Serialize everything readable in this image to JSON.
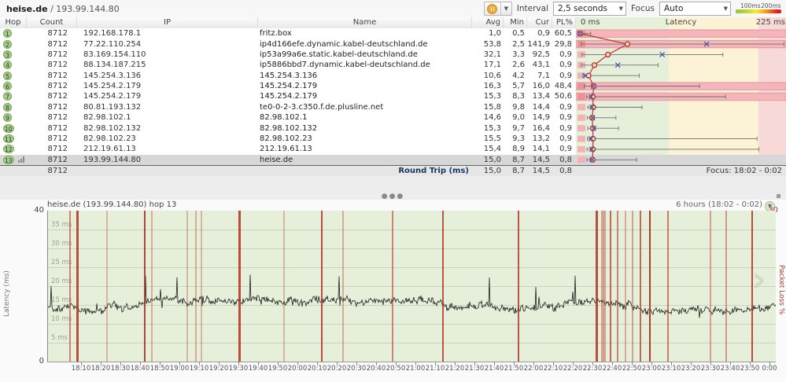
{
  "titlebar": {
    "host": "heise.de",
    "sep": " / ",
    "ip": "193.99.144.80",
    "interval": {
      "label": "Interval",
      "value": "2,5 seconds"
    },
    "focus": {
      "label": "Focus",
      "value": "Auto"
    },
    "scale_legend": {
      "label1": "100ms",
      "label2": "200ms"
    }
  },
  "table": {
    "headers": {
      "hop": "Hop",
      "count": "Count",
      "ip": "IP",
      "name": "Name",
      "avg": "Avg",
      "min": "Min",
      "cur": "Cur",
      "pl": "PL%"
    },
    "latency_axis": {
      "min": "0 ms",
      "title": "Latency",
      "max": "225 ms",
      "scale_max_ms": 225,
      "zone_green_ms": 100,
      "zone_yellow_ms": 200
    },
    "rows": [
      {
        "hop": "1",
        "count": "8712",
        "ip": "192.168.178.1",
        "name": "fritz.box",
        "avg": "1,0",
        "min": "0,5",
        "cur": "0,9",
        "pl": "60,5",
        "graph": {
          "min": 0.5,
          "avg": 1.0,
          "cur": 0.9,
          "max": 13,
          "loss_band": true
        },
        "selected": false
      },
      {
        "hop": "2",
        "count": "8712",
        "ip": "77.22.110.254",
        "name": "ip4d166efe.dynamic.kabel-deutschland.de",
        "avg": "53,8",
        "min": "2,5",
        "cur": "141,9",
        "pl": "29,8",
        "graph": {
          "min": 2.5,
          "avg": 53.8,
          "cur": 141.9,
          "max": 228,
          "loss_band": true
        },
        "selected": false
      },
      {
        "hop": "3",
        "count": "8712",
        "ip": "83.169.154.110",
        "name": "ip53a99a6e.static.kabel-deutschland.de",
        "avg": "32,1",
        "min": "3,3",
        "cur": "92,5",
        "pl": "0,9",
        "graph": {
          "min": 3.3,
          "avg": 32.1,
          "cur": 92.5,
          "max": 160,
          "loss_band": false
        },
        "selected": false
      },
      {
        "hop": "4",
        "count": "8712",
        "ip": "88.134.187.215",
        "name": "ip5886bbd7.dynamic.kabel-deutschland.de",
        "avg": "17,1",
        "min": "2,6",
        "cur": "43,1",
        "pl": "0,9",
        "graph": {
          "min": 2.6,
          "avg": 17.1,
          "cur": 43.1,
          "max": 88,
          "loss_band": false
        },
        "selected": false
      },
      {
        "hop": "5",
        "count": "8712",
        "ip": "145.254.3.136",
        "name": "145.254.3.136",
        "avg": "10,6",
        "min": "4,2",
        "cur": "7,1",
        "pl": "0,9",
        "graph": {
          "min": 4.2,
          "avg": 10.6,
          "cur": 7.1,
          "max": 67,
          "loss_band": false
        },
        "selected": false
      },
      {
        "hop": "6",
        "count": "8712",
        "ip": "145.254.2.179",
        "name": "145.254.2.179",
        "avg": "16,3",
        "min": "5,7",
        "cur": "16,0",
        "pl": "48,4",
        "graph": {
          "min": 5.7,
          "avg": 16.3,
          "cur": 16.0,
          "max": 134,
          "loss_band": true
        },
        "selected": false
      },
      {
        "hop": "7",
        "count": "8712",
        "ip": "145.254.2.179",
        "name": "145.254.2.179",
        "avg": "15,3",
        "min": "8,3",
        "cur": "13,4",
        "pl": "50,6",
        "graph": {
          "min": 8.3,
          "avg": 15.3,
          "cur": 13.4,
          "max": 163,
          "loss_band": true
        },
        "selected": false
      },
      {
        "hop": "8",
        "count": "8712",
        "ip": "80.81.193.132",
        "name": "te0-0-2-3.c350.f.de.plusline.net",
        "avg": "15,8",
        "min": "9,8",
        "cur": "14,4",
        "pl": "0,9",
        "graph": {
          "min": 9.8,
          "avg": 15.8,
          "cur": 14.4,
          "max": 70,
          "loss_band": false
        },
        "selected": false
      },
      {
        "hop": "9",
        "count": "8712",
        "ip": "82.98.102.1",
        "name": "82.98.102.1",
        "avg": "14,6",
        "min": "9,0",
        "cur": "14,9",
        "pl": "0,9",
        "graph": {
          "min": 9.0,
          "avg": 14.6,
          "cur": 14.9,
          "max": 41,
          "loss_band": false
        },
        "selected": false
      },
      {
        "hop": "10",
        "count": "8712",
        "ip": "82.98.102.132",
        "name": "82.98.102.132",
        "avg": "15,3",
        "min": "9,7",
        "cur": "16,4",
        "pl": "0,9",
        "graph": {
          "min": 9.7,
          "avg": 15.3,
          "cur": 16.4,
          "max": 44,
          "loss_band": false
        },
        "selected": false
      },
      {
        "hop": "11",
        "count": "8712",
        "ip": "82.98.102.23",
        "name": "82.98.102.23",
        "avg": "15,5",
        "min": "9,3",
        "cur": "13,2",
        "pl": "0,9",
        "graph": {
          "min": 9.3,
          "avg": 15.5,
          "cur": 13.2,
          "max": 198,
          "loss_band": false
        },
        "selected": false
      },
      {
        "hop": "12",
        "count": "8712",
        "ip": "212.19.61.13",
        "name": "212.19.61.13",
        "avg": "15,4",
        "min": "8,9",
        "cur": "14,1",
        "pl": "0,9",
        "graph": {
          "min": 8.9,
          "avg": 15.4,
          "cur": 14.1,
          "max": 200,
          "loss_band": false
        },
        "selected": false
      },
      {
        "hop": "13",
        "count": "8712",
        "ip": "193.99.144.80",
        "name": "heise.de",
        "avg": "15,0",
        "min": "8,7",
        "cur": "14,5",
        "pl": "0,8",
        "graph": {
          "min": 8.7,
          "avg": 15.0,
          "cur": 14.5,
          "max": 64,
          "loss_band": false
        },
        "selected": true
      }
    ],
    "footer": {
      "count": "8712",
      "label": "Round Trip (ms)",
      "avg": "15,0",
      "min": "8,7",
      "cur": "14,5",
      "pl": "0,8",
      "focus": "Focus: 18:02 - 0:02"
    }
  },
  "timeline": {
    "title": "heise.de (193.99.144.80) hop 13",
    "range_label": "6 hours (18:02 - 0:02)",
    "ylabel": "Latency (ms)",
    "pl_axis_label": "Packet Loss %",
    "y_top": "40",
    "y_bottom": "0",
    "pl_top": "30",
    "y_max_ms": 40,
    "grid_labels": [
      "35 ms",
      "30 ms",
      "25 ms",
      "20 ms",
      "15 ms",
      "10 ms",
      "5 ms"
    ],
    "time_labels": [
      "18:10",
      "18:20",
      "18:30",
      "18:40",
      "18:50",
      "19:00",
      "19:10",
      "19:20",
      "19:30",
      "19:40",
      "19:50",
      "20:00",
      "20:10",
      "20:20",
      "20:30",
      "20:40",
      "20:50",
      "21:00",
      "21:10",
      "21:20",
      "21:30",
      "21:40",
      "21:50",
      "22:00",
      "22:10",
      "22:20",
      "22:30",
      "22:40",
      "22:50",
      "23:00",
      "23:10",
      "23:20",
      "23:30",
      "23:40",
      "23:50",
      "0:00"
    ],
    "first_label_frac": 0.0465,
    "label_step_frac": 0.027027,
    "trace": {
      "baseline_ms": 14.5,
      "noise_ms": 1.6,
      "spike_max_ms": 22,
      "seed": 42
    },
    "loss_events": [
      [
        0.03,
        0.55,
        2
      ],
      [
        0.041,
        0.85,
        3
      ],
      [
        0.081,
        0.3,
        2
      ],
      [
        0.133,
        0.9,
        2
      ],
      [
        0.143,
        0.35,
        2
      ],
      [
        0.191,
        0.3,
        2
      ],
      [
        0.203,
        0.35,
        2
      ],
      [
        0.211,
        0.3,
        2
      ],
      [
        0.263,
        0.85,
        3
      ],
      [
        0.324,
        0.3,
        2
      ],
      [
        0.376,
        0.85,
        2
      ],
      [
        0.405,
        0.35,
        2
      ],
      [
        0.474,
        0.55,
        2
      ],
      [
        0.543,
        0.8,
        2
      ],
      [
        0.646,
        0.8,
        2
      ],
      [
        0.754,
        0.85,
        3
      ],
      [
        0.763,
        0.4,
        6
      ],
      [
        0.773,
        0.7,
        2
      ],
      [
        0.783,
        0.55,
        2
      ],
      [
        0.793,
        0.35,
        2
      ],
      [
        0.803,
        0.4,
        2
      ],
      [
        0.814,
        0.7,
        2
      ],
      [
        0.827,
        0.95,
        2
      ],
      [
        0.852,
        0.6,
        2
      ],
      [
        0.91,
        0.4,
        2
      ],
      [
        0.932,
        0.45,
        2
      ],
      [
        0.968,
        0.85,
        2
      ]
    ]
  },
  "colors": {
    "zone_green": "#e6efda",
    "zone_yellow": "#fcf2d5",
    "zone_pink": "#f7dad7",
    "band_fill": "#f4b6ba",
    "band_edge": "#e6959c",
    "avg_line": "#bf4136",
    "cur_marker": "#4d4da8",
    "event_red": "178,48,30"
  }
}
